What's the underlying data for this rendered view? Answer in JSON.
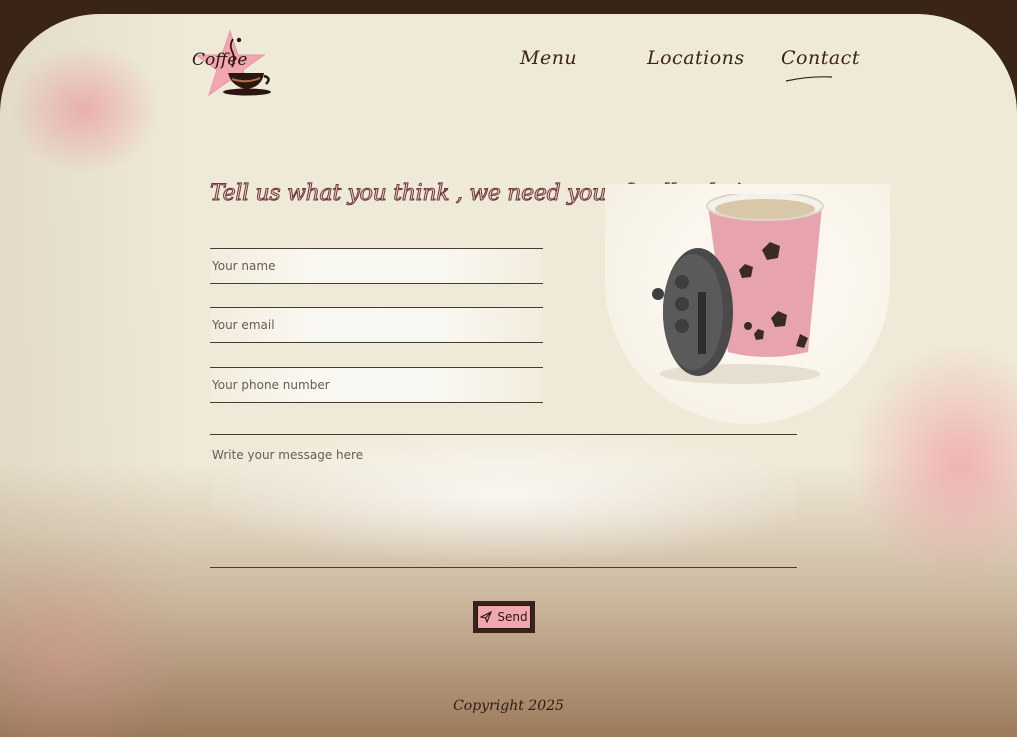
{
  "header": {
    "logo_text": "Coffee",
    "nav": [
      {
        "label": "Menu"
      },
      {
        "label": "Locations"
      },
      {
        "label": "Contact"
      }
    ]
  },
  "form": {
    "heading": "Tell us what you think , we need your feedback :)",
    "name_placeholder": "Your name",
    "email_placeholder": "Your email",
    "phone_placeholder": "Your phone number",
    "message_placeholder": "Write your message here",
    "send_label": "Send"
  },
  "footer": {
    "copyright": "Copyright 2025"
  },
  "icons": {
    "logo": "coffee-cup-star-icon",
    "send": "paper-plane-icon"
  },
  "colors": {
    "accent_pink": "#f0a8b0",
    "dark_brown": "#3a2418",
    "cream": "#efead8"
  }
}
